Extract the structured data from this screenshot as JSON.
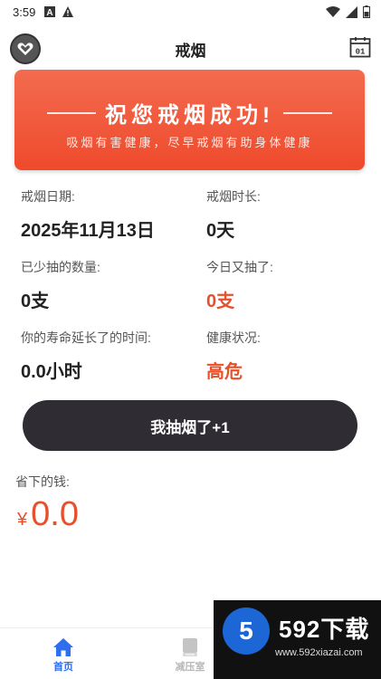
{
  "status_bar": {
    "time": "3:59"
  },
  "header": {
    "title": "戒烟",
    "left_icon": "heart-badge-icon",
    "right_icon": "calendar-icon",
    "calendar_day": "01"
  },
  "banner": {
    "headline": "祝您戒烟成功!",
    "subtitle": "吸烟有害健康，尽早戒烟有助身体健康",
    "colors": {
      "start": "#f36b4f",
      "end": "#ef4a2c"
    }
  },
  "stats": {
    "quit_date_label": "戒烟日期:",
    "quit_date_value": "2025年11月13日",
    "duration_label": "戒烟时长:",
    "duration_value": "0天",
    "reduced_label": "已少抽的数量:",
    "reduced_value": "0支",
    "today_label": "今日又抽了:",
    "today_value": "0支",
    "life_label": "你的寿命延长了的时间:",
    "life_value": "0.0小时",
    "health_label": "健康状况:",
    "health_value": "高危"
  },
  "smoke_button": {
    "label": "我抽烟了+1"
  },
  "money": {
    "label": "省下的钱:",
    "currency": "¥",
    "amount": "0.0"
  },
  "bottom_nav": {
    "items": [
      {
        "label": "首页",
        "icon": "home-icon",
        "active": true
      },
      {
        "label": "减压室",
        "icon": "book-icon",
        "active": false
      }
    ]
  },
  "watermark": {
    "logo_char": "5",
    "brand": "592下载",
    "url": "www.592xiazai.com"
  },
  "colors": {
    "accent_red": "#e8502c",
    "nav_active": "#2e6ff0",
    "button_dark": "#2f2c33"
  }
}
